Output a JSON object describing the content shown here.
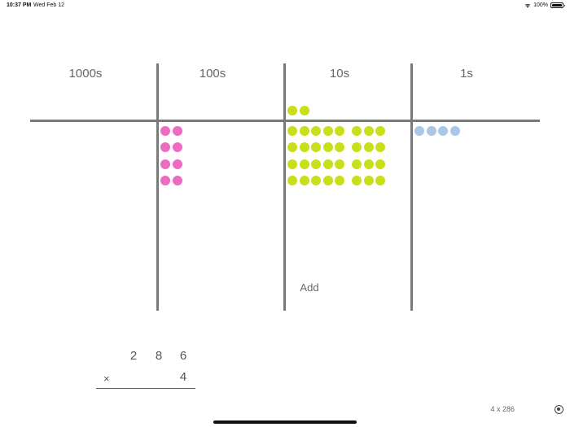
{
  "status_bar": {
    "time": "10:37 PM",
    "date": "Wed Feb 12",
    "battery": "100%",
    "icons": [
      "wifi-icon",
      "battery-icon"
    ]
  },
  "place_value": {
    "columns": [
      "1000s",
      "100s",
      "10s",
      "1s"
    ],
    "carry_tens_count": 2,
    "hundreds_count": 8,
    "tens_count": 32,
    "ones_count": 4,
    "colors": {
      "hundreds": "#ec6cc3",
      "tens": "#c8df1a",
      "ones": "#a9c7e6",
      "lines": "#7a7a7a"
    }
  },
  "add_label": "Add",
  "problem": {
    "top_digits": [
      "2",
      "8",
      "6"
    ],
    "operator": "×",
    "bottom_digit": "4"
  },
  "problem_label": "4 x 286"
}
